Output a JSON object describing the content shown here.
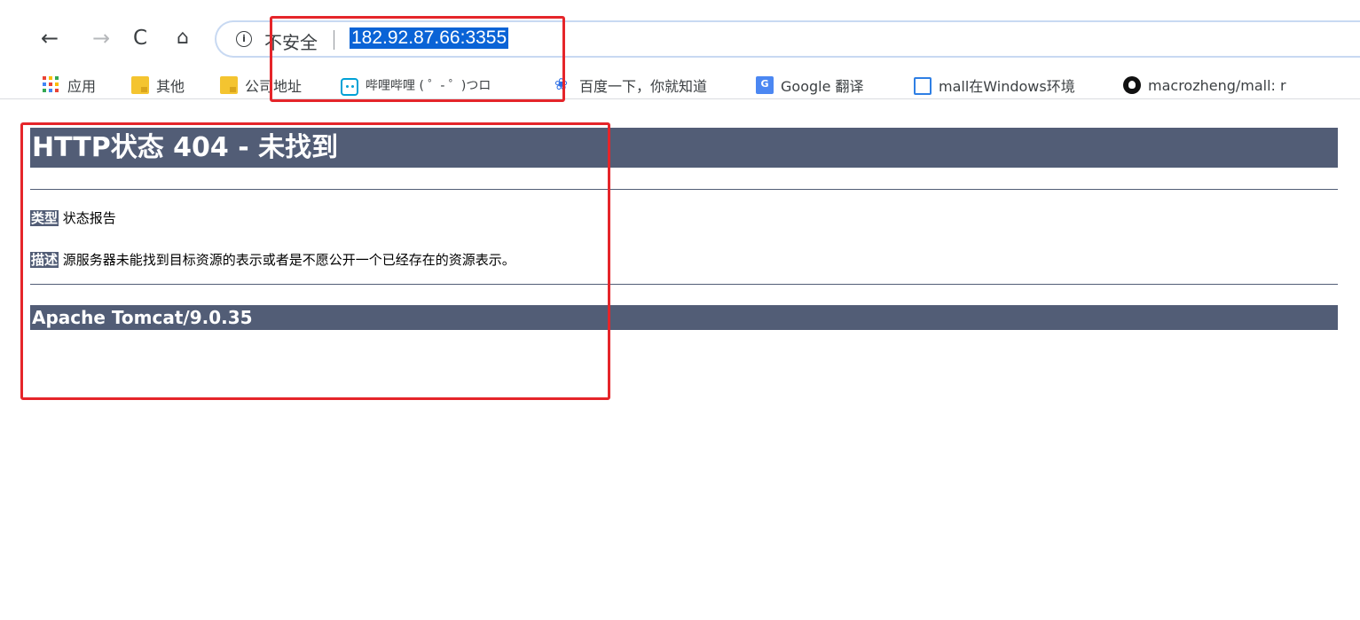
{
  "browser": {
    "back_icon": "arrow-left-icon",
    "forward_icon": "arrow-right-icon",
    "reload_icon": "reload-icon",
    "home_icon": "home-icon",
    "security_label": "不安全",
    "url": "182.92.87.66:3355"
  },
  "bookmarks": [
    {
      "label": "应用",
      "icon": "apps-grid-icon"
    },
    {
      "label": "其他",
      "icon": "folder-icon"
    },
    {
      "label": "公司地址",
      "icon": "folder-icon"
    },
    {
      "label": "哔哩哔哩 ( ゜- ゜)つロ",
      "icon": "bilibili-tv-icon"
    },
    {
      "label": "百度一下，你就知道",
      "icon": "baidu-paw-icon"
    },
    {
      "label": "Google 翻译",
      "icon": "google-translate-icon"
    },
    {
      "label": "mall在Windows环境",
      "icon": "storefront-icon"
    },
    {
      "label": "macrozheng/mall: r",
      "icon": "github-icon"
    }
  ],
  "page": {
    "heading": "HTTP状态 404 - 未找到",
    "type_label": "类型",
    "type_value": "状态报告",
    "desc_label": "描述",
    "desc_value": "源服务器未能找到目标资源的表示或者是不愿公开一个已经存在的资源表示。",
    "footer": "Apache Tomcat/9.0.35"
  },
  "colors": {
    "tomcat_header": "#525d76",
    "annotation": "#e5252a",
    "url_selection": "#0a63d6"
  }
}
